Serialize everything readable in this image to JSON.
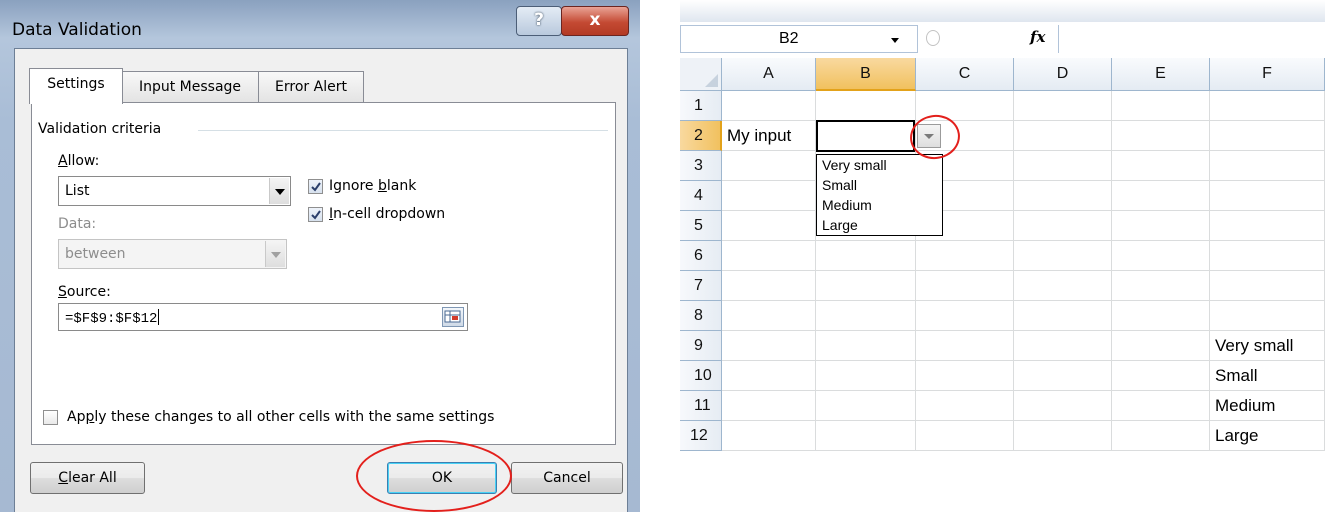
{
  "dialog": {
    "title": "Data Validation",
    "help_label": "?",
    "close_label": "x",
    "tabs": [
      {
        "label": "Settings"
      },
      {
        "label": "Input Message"
      },
      {
        "label": "Error Alert"
      }
    ],
    "section": "Validation criteria",
    "allow": {
      "label_pre": "",
      "label_key": "A",
      "label_post": "llow:",
      "value": "List"
    },
    "ignore_blank": {
      "label_pre": "Ignore ",
      "label_key": "b",
      "label_post": "lank",
      "checked": true
    },
    "in_cell_dropdown": {
      "label_pre": "",
      "label_key": "I",
      "label_post": "n-cell dropdown",
      "checked": true
    },
    "data": {
      "label": "Data:",
      "value": "between"
    },
    "source": {
      "label_pre": "",
      "label_key": "S",
      "label_post": "ource:",
      "value": "=$F$9:$F$12"
    },
    "apply_all": {
      "label_pre": "Ap",
      "label_key": "p",
      "label_post": "ly these changes to all other cells with the same settings",
      "checked": false
    },
    "buttons": {
      "clear_pre": "",
      "clear_key": "C",
      "clear_post": "lear All",
      "ok": "OK",
      "cancel": "Cancel"
    },
    "highlight_color": "#e3201c"
  },
  "excel": {
    "name_box": "B2",
    "fx_label": "fx",
    "columns": [
      "A",
      "B",
      "C",
      "D",
      "E",
      "F"
    ],
    "selected_column": "B",
    "rows": [
      "1",
      "2",
      "3",
      "4",
      "5",
      "6",
      "7",
      "8",
      "9",
      "10",
      "11",
      "12"
    ],
    "selected_row": "2",
    "cells": {
      "A2": "My input",
      "F9": "Very small",
      "F10": "Small",
      "F11": "Medium",
      "F12": "Large"
    },
    "dropdown_items": [
      "Very small",
      "Small",
      "Medium",
      "Large"
    ]
  }
}
